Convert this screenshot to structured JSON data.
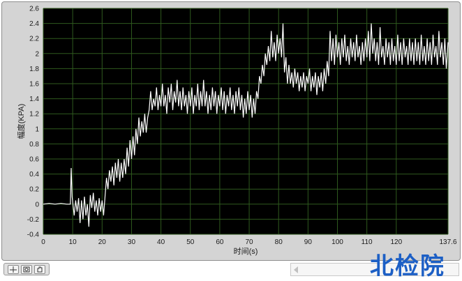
{
  "chart_data": {
    "type": "line",
    "ylabel": "幅度(KPA)",
    "xlabel": "时间(s)",
    "xlim": [
      0,
      137.6
    ],
    "ylim": [
      -0.4,
      2.6
    ],
    "x_ticks": [
      "0",
      "10",
      "20",
      "30",
      "40",
      "50",
      "60",
      "70",
      "80",
      "90",
      "100",
      "110",
      "120",
      "137.6"
    ],
    "x_tick_values": [
      0,
      10,
      20,
      30,
      40,
      50,
      60,
      70,
      80,
      90,
      100,
      110,
      120,
      137.6
    ],
    "y_ticks": [
      "-0.4",
      "-0.2",
      "0",
      "0.2",
      "0.4",
      "0.6",
      "0.8",
      "1",
      "1.2",
      "1.4",
      "1.6",
      "1.8",
      "2",
      "2.2",
      "2.4",
      "2.6"
    ],
    "y_tick_values": [
      -0.4,
      -0.2,
      0,
      0.2,
      0.4,
      0.6,
      0.8,
      1,
      1.2,
      1.4,
      1.6,
      1.8,
      2,
      2.2,
      2.4,
      2.6
    ],
    "grid": true,
    "background": "#000000",
    "grid_color": "#2f5a1e",
    "line_color": "#ffffff",
    "series": [
      {
        "values": [
          [
            0,
            0.0
          ],
          [
            2,
            0.01
          ],
          [
            4,
            0.0
          ],
          [
            6,
            0.01
          ],
          [
            8,
            0.0
          ],
          [
            9.2,
            0.0
          ],
          [
            9.5,
            0.48
          ],
          [
            9.8,
            0.1
          ],
          [
            10.5,
            -0.15
          ],
          [
            11,
            0.05
          ],
          [
            11.5,
            -0.1
          ],
          [
            12,
            0.08
          ],
          [
            12.5,
            -0.25
          ],
          [
            13,
            0.05
          ],
          [
            13.5,
            -0.2
          ],
          [
            14,
            0.1
          ],
          [
            14.5,
            -0.15
          ],
          [
            15,
            0.0
          ],
          [
            15.5,
            -0.3
          ],
          [
            16,
            0.12
          ],
          [
            16.5,
            -0.05
          ],
          [
            17,
            0.15
          ],
          [
            17.5,
            -0.1
          ],
          [
            18,
            0.05
          ],
          [
            18.5,
            -0.15
          ],
          [
            19,
            0.08
          ],
          [
            19.5,
            -0.1
          ],
          [
            20,
            0.05
          ],
          [
            20.5,
            -0.15
          ],
          [
            21,
            0.1
          ],
          [
            21.5,
            0.35
          ],
          [
            22,
            0.2
          ],
          [
            22.5,
            0.45
          ],
          [
            23,
            0.3
          ],
          [
            23.5,
            0.5
          ],
          [
            24,
            0.25
          ],
          [
            24.5,
            0.55
          ],
          [
            25,
            0.35
          ],
          [
            25.5,
            0.6
          ],
          [
            26,
            0.3
          ],
          [
            26.5,
            0.55
          ],
          [
            27,
            0.35
          ],
          [
            27.5,
            0.6
          ],
          [
            28,
            0.4
          ],
          [
            28.5,
            0.75
          ],
          [
            29,
            0.5
          ],
          [
            29.5,
            0.85
          ],
          [
            30,
            0.6
          ],
          [
            30.5,
            0.9
          ],
          [
            31,
            0.65
          ],
          [
            31.5,
            1.0
          ],
          [
            32,
            0.8
          ],
          [
            32.5,
            1.15
          ],
          [
            33,
            0.9
          ],
          [
            33.5,
            1.1
          ],
          [
            34,
            0.95
          ],
          [
            34.5,
            1.2
          ],
          [
            35,
            0.95
          ],
          [
            35.5,
            1.15
          ],
          [
            36,
            1.25
          ],
          [
            36.5,
            1.5
          ],
          [
            37,
            1.25
          ],
          [
            37.5,
            1.4
          ],
          [
            38,
            1.3
          ],
          [
            38.5,
            1.55
          ],
          [
            39,
            1.25
          ],
          [
            39.5,
            1.45
          ],
          [
            40,
            1.3
          ],
          [
            40.5,
            1.6
          ],
          [
            41,
            1.3
          ],
          [
            41.5,
            1.45
          ],
          [
            42,
            1.2
          ],
          [
            42.5,
            1.55
          ],
          [
            43,
            1.35
          ],
          [
            43.5,
            1.6
          ],
          [
            44,
            1.25
          ],
          [
            44.5,
            1.5
          ],
          [
            45,
            1.35
          ],
          [
            45.5,
            1.65
          ],
          [
            46,
            1.3
          ],
          [
            46.5,
            1.5
          ],
          [
            47,
            1.25
          ],
          [
            47.5,
            1.55
          ],
          [
            48,
            1.3
          ],
          [
            48.5,
            1.45
          ],
          [
            49,
            1.2
          ],
          [
            49.5,
            1.5
          ],
          [
            50,
            1.3
          ],
          [
            50.5,
            1.55
          ],
          [
            51,
            1.2
          ],
          [
            51.5,
            1.45
          ],
          [
            52,
            1.3
          ],
          [
            52.5,
            1.6
          ],
          [
            53,
            1.25
          ],
          [
            53.5,
            1.5
          ],
          [
            54,
            1.3
          ],
          [
            54.5,
            1.65
          ],
          [
            55,
            1.3
          ],
          [
            55.5,
            1.5
          ],
          [
            56,
            1.2
          ],
          [
            56.5,
            1.45
          ],
          [
            57,
            1.25
          ],
          [
            57.5,
            1.55
          ],
          [
            58,
            1.3
          ],
          [
            58.5,
            1.5
          ],
          [
            59,
            1.2
          ],
          [
            59.5,
            1.45
          ],
          [
            60,
            1.3
          ],
          [
            60.5,
            1.55
          ],
          [
            61,
            1.25
          ],
          [
            61.5,
            1.5
          ],
          [
            62,
            1.2
          ],
          [
            62.5,
            1.45
          ],
          [
            63,
            1.3
          ],
          [
            63.5,
            1.55
          ],
          [
            64,
            1.25
          ],
          [
            64.5,
            1.45
          ],
          [
            65,
            1.2
          ],
          [
            65.5,
            1.5
          ],
          [
            66,
            1.3
          ],
          [
            66.5,
            1.55
          ],
          [
            67,
            1.25
          ],
          [
            67.5,
            1.45
          ],
          [
            68,
            1.15
          ],
          [
            68.5,
            1.4
          ],
          [
            69,
            1.2
          ],
          [
            69.5,
            1.5
          ],
          [
            70,
            1.25
          ],
          [
            70.5,
            1.45
          ],
          [
            71,
            1.15
          ],
          [
            71.5,
            1.4
          ],
          [
            72,
            1.2
          ],
          [
            72.5,
            1.5
          ],
          [
            73,
            1.4
          ],
          [
            73.5,
            1.7
          ],
          [
            74,
            1.6
          ],
          [
            74.5,
            1.85
          ],
          [
            75,
            1.7
          ],
          [
            75.5,
            2.0
          ],
          [
            76,
            1.85
          ],
          [
            76.5,
            2.1
          ],
          [
            77,
            1.9
          ],
          [
            77.5,
            2.3
          ],
          [
            78,
            1.95
          ],
          [
            78.5,
            2.15
          ],
          [
            79,
            1.9
          ],
          [
            79.5,
            2.25
          ],
          [
            80,
            2.0
          ],
          [
            80.5,
            2.2
          ],
          [
            81,
            1.95
          ],
          [
            81.5,
            2.4
          ],
          [
            82,
            1.75
          ],
          [
            82.5,
            1.95
          ],
          [
            83,
            1.6
          ],
          [
            83.5,
            1.85
          ],
          [
            84,
            1.6
          ],
          [
            84.5,
            1.75
          ],
          [
            85,
            1.55
          ],
          [
            85.5,
            1.8
          ],
          [
            86,
            1.6
          ],
          [
            86.5,
            1.75
          ],
          [
            87,
            1.5
          ],
          [
            87.5,
            1.7
          ],
          [
            88,
            1.55
          ],
          [
            88.5,
            1.75
          ],
          [
            89,
            1.5
          ],
          [
            89.5,
            1.7
          ],
          [
            90,
            1.6
          ],
          [
            90.5,
            1.8
          ],
          [
            91,
            1.5
          ],
          [
            91.5,
            1.7
          ],
          [
            92,
            1.55
          ],
          [
            92.5,
            1.75
          ],
          [
            93,
            1.45
          ],
          [
            93.5,
            1.7
          ],
          [
            94,
            1.55
          ],
          [
            94.5,
            1.75
          ],
          [
            95,
            1.5
          ],
          [
            95.5,
            1.8
          ],
          [
            96,
            1.6
          ],
          [
            96.5,
            1.9
          ],
          [
            97,
            1.7
          ],
          [
            97.5,
            2.3
          ],
          [
            98,
            1.9
          ],
          [
            98.5,
            2.2
          ],
          [
            99,
            1.85
          ],
          [
            99.5,
            2.25
          ],
          [
            100,
            1.95
          ],
          [
            100.5,
            2.15
          ],
          [
            101,
            1.85
          ],
          [
            101.5,
            2.2
          ],
          [
            102,
            1.95
          ],
          [
            102.5,
            2.25
          ],
          [
            103,
            1.9
          ],
          [
            103.5,
            2.1
          ],
          [
            104,
            1.85
          ],
          [
            104.5,
            2.2
          ],
          [
            105,
            1.95
          ],
          [
            105.5,
            2.15
          ],
          [
            106,
            1.9
          ],
          [
            106.5,
            2.25
          ],
          [
            107,
            1.95
          ],
          [
            107.5,
            2.1
          ],
          [
            108,
            1.85
          ],
          [
            108.5,
            2.15
          ],
          [
            109,
            1.9
          ],
          [
            109.5,
            2.2
          ],
          [
            110,
            1.95
          ],
          [
            110.5,
            2.3
          ],
          [
            111,
            1.9
          ],
          [
            111.5,
            2.4
          ],
          [
            112,
            2.0
          ],
          [
            112.5,
            2.2
          ],
          [
            113,
            1.9
          ],
          [
            113.5,
            2.15
          ],
          [
            114,
            1.85
          ],
          [
            114.5,
            2.35
          ],
          [
            115,
            1.95
          ],
          [
            115.5,
            2.1
          ],
          [
            116,
            1.85
          ],
          [
            116.5,
            2.2
          ],
          [
            117,
            1.95
          ],
          [
            117.5,
            2.15
          ],
          [
            118,
            1.85
          ],
          [
            118.5,
            2.2
          ],
          [
            119,
            1.9
          ],
          [
            119.5,
            2.1
          ],
          [
            120,
            1.85
          ],
          [
            120.5,
            2.25
          ],
          [
            121,
            1.9
          ],
          [
            121.5,
            2.15
          ],
          [
            122,
            1.85
          ],
          [
            122.5,
            2.2
          ],
          [
            123,
            1.95
          ],
          [
            123.5,
            2.1
          ],
          [
            124,
            1.85
          ],
          [
            124.5,
            2.2
          ],
          [
            125,
            1.9
          ],
          [
            125.5,
            2.15
          ],
          [
            126,
            1.85
          ],
          [
            126.5,
            2.2
          ],
          [
            127,
            1.9
          ],
          [
            127.5,
            2.15
          ],
          [
            128,
            1.85
          ],
          [
            128.5,
            2.25
          ],
          [
            129,
            1.9
          ],
          [
            129.5,
            2.1
          ],
          [
            130,
            1.85
          ],
          [
            130.5,
            2.2
          ],
          [
            131,
            1.9
          ],
          [
            131.5,
            2.15
          ],
          [
            132,
            1.85
          ],
          [
            132.5,
            2.25
          ],
          [
            133,
            1.95
          ],
          [
            133.5,
            2.1
          ],
          [
            134,
            1.85
          ],
          [
            134.5,
            2.3
          ],
          [
            135,
            1.95
          ],
          [
            135.5,
            2.15
          ],
          [
            136,
            1.85
          ],
          [
            136.5,
            2.2
          ],
          [
            137,
            1.8
          ],
          [
            137.6,
            2.15
          ]
        ]
      }
    ]
  },
  "watermark": "北检院",
  "palette": {
    "buttons": [
      "cursor-tool-icon",
      "zoom-tool-icon",
      "pan-hand-icon"
    ]
  }
}
